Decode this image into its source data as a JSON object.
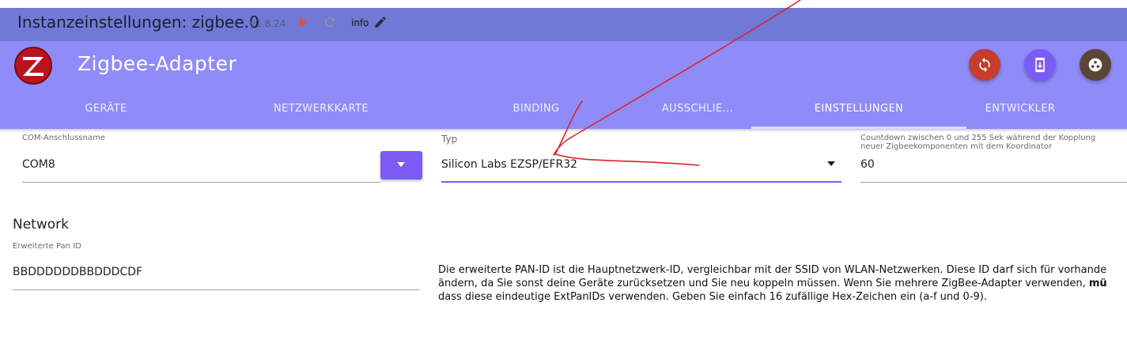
{
  "topbar": {
    "title": "Instanzeinstellungen: zigbee.0",
    "version": "v1.8.24",
    "info_label": "info",
    "icons": [
      "play-icon",
      "reload-icon",
      "edit-icon"
    ]
  },
  "appbar": {
    "title": "Zigbee-Adapter",
    "actions": [
      "sync-icon",
      "download-device-icon",
      "network-icon"
    ],
    "colors": {
      "background": "#8f8cf9",
      "topbar": "#7079d6",
      "accent": "#7c5cf5"
    }
  },
  "tabs": [
    {
      "label": "GERÄTE"
    },
    {
      "label": "NETZWERKKARTE"
    },
    {
      "label": "BINDING"
    },
    {
      "label": "AUSSCHLIE..."
    },
    {
      "label": "EINSTELLUNGEN",
      "active": true
    },
    {
      "label": "ENTWICKLER"
    }
  ],
  "settings": {
    "com": {
      "label": "COM-Anschlussname",
      "value": "COM8"
    },
    "type": {
      "label": "Typ",
      "value": "Silicon Labs EZSP/EFR32"
    },
    "countdown": {
      "label_line1": "Countdown zwischen 0 und 255 Sek während der Kopplung",
      "label_line2": "neuer Zigbeekomponenten mit dem Koordinator",
      "value": "60"
    }
  },
  "network": {
    "title": "Network",
    "panid": {
      "label": "Erweiterte Pan ID",
      "value": "BBDDDDDDBBDDDCDF"
    },
    "desc": {
      "line1": "Die erweiterte PAN-ID ist die Hauptnetzwerk-ID, vergleichbar mit der SSID von WLAN-Netzwerken. Diese ID darf sich für vorhande",
      "line2_pre": "ändern, da Sie sonst deine Geräte zurücksetzen und Sie neu koppeln müssen. Wenn Sie mehrere ZigBee-Adapter verwenden, ",
      "line2_bold": "mü",
      "line3": "dass diese eindeutige ExtPanIDs verwenden. Geben Sie einfach 16 zufällige Hex-Zeichen ein (a-f und 0-9)."
    }
  }
}
